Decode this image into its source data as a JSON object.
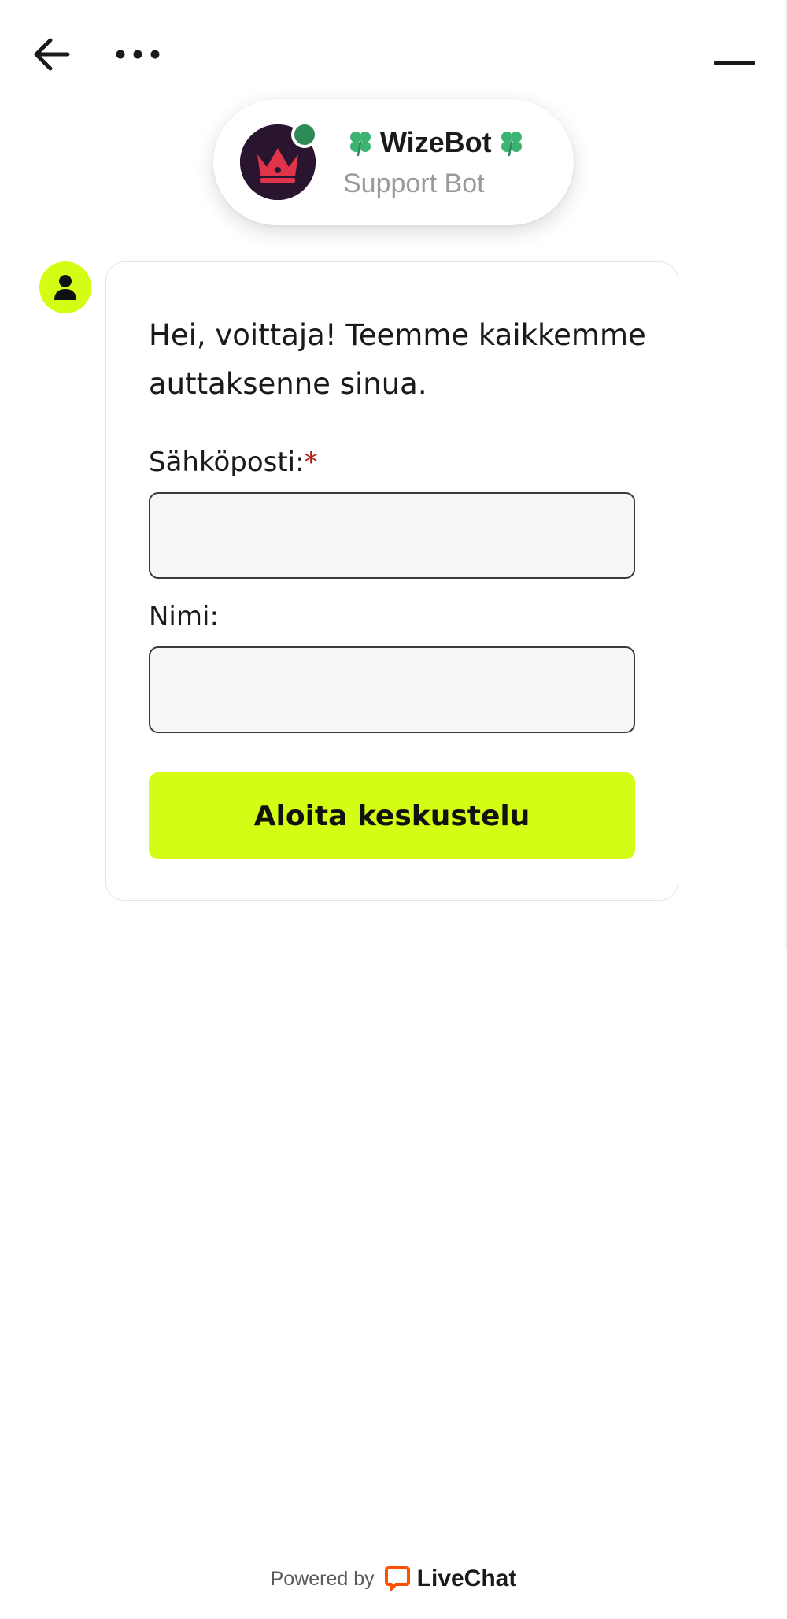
{
  "header": {
    "back_icon": "arrow-left-icon",
    "more_icon": "more-horizontal-icon",
    "minimize_icon": "minimize-icon"
  },
  "agent": {
    "name": "WizeBot",
    "role": "Support Bot",
    "decoration_icon": "four-leaf-clover-icon",
    "avatar_icon": "crown-icon",
    "status_color": "#2e8b57"
  },
  "form": {
    "greeting": "Hei, voittaja! Teemme kaikkemme auttaksenne sinua.",
    "email_label": "Sähköposti:",
    "required_mark": "*",
    "email_value": "",
    "name_label": "Nimi:",
    "name_value": "",
    "submit_label": "Aloita keskustelu"
  },
  "footer": {
    "powered_by": "Powered by",
    "brand": "LiveChat"
  },
  "colors": {
    "accent": "#d4fd15",
    "brand_orange": "#ff5100",
    "required": "#b01c1c"
  }
}
